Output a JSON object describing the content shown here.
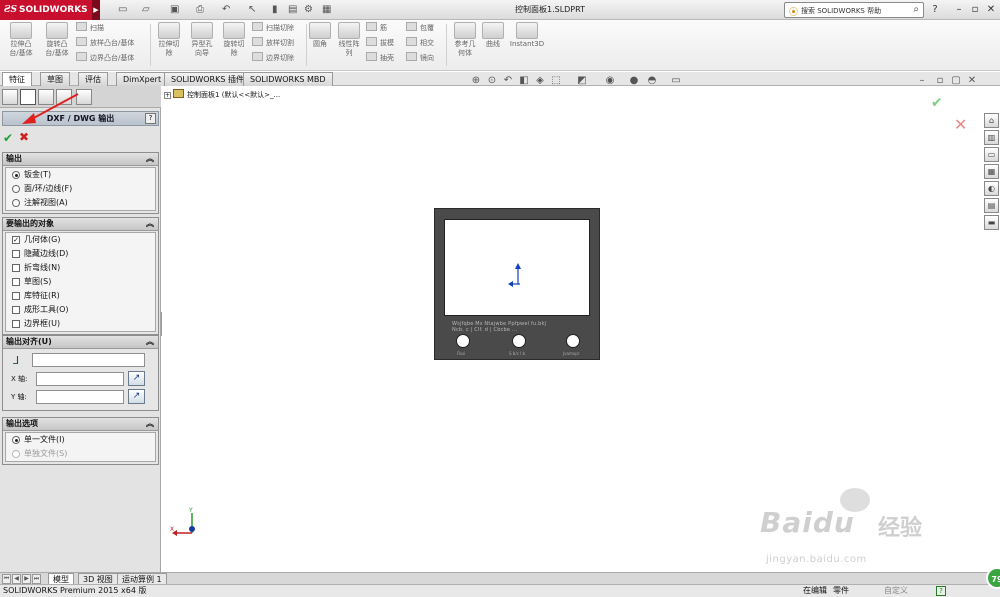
{
  "app": {
    "brand": "SOLIDWORKS",
    "document_title": "控制面板1.SLDPRT"
  },
  "search": {
    "placeholder": "搜索 SOLIDWORKS 帮助"
  },
  "icons": [
    "solidworks-logo",
    "new-icon",
    "open-icon",
    "save-icon",
    "print-icon",
    "undo-icon",
    "select-icon",
    "rebuild-icon",
    "options-icon",
    "search-icon",
    "help-icon",
    "minimize-icon",
    "restore-icon",
    "close-icon"
  ],
  "ribbon": {
    "big_buttons": [
      {
        "label": "拉伸凸\n台/基体"
      },
      {
        "label": "旋转凸\n台/基体"
      },
      {
        "label": "拉伸切\n除"
      },
      {
        "label": "异型孔\n向导"
      },
      {
        "label": "旋转切\n除"
      },
      {
        "label": "圆角"
      },
      {
        "label": "线性阵\n列"
      },
      {
        "label": "参考几\n何体"
      },
      {
        "label": "曲线"
      },
      {
        "label": "Instant3D"
      }
    ],
    "small_col1": [
      "扫描",
      "放样凸台/基体",
      "边界凸台/基体"
    ],
    "small_col2": [
      "扫描切除",
      "放样切割",
      "边界切除"
    ],
    "small_col3": [
      "筋",
      "拔模",
      "抽壳"
    ],
    "small_col4": [
      "包覆",
      "相交",
      "镜向"
    ]
  },
  "tabs": [
    "特征",
    "草图",
    "评估",
    "DimXpert",
    "SOLIDWORKS 插件",
    "SOLIDWORKS MBD"
  ],
  "pm": {
    "title": "DXF / DWG 输出",
    "help": "?",
    "groups": {
      "output": {
        "title": "输出",
        "options": [
          "钣金(T)",
          "面/环/边线(F)",
          "注解视图(A)"
        ],
        "selected": 0
      },
      "entities": {
        "title": "要输出的对象",
        "options": [
          "几何体(G)",
          "隐藏边线(D)",
          "折弯线(N)",
          "草图(S)",
          "库特征(R)",
          "成形工具(O)",
          "边界框(U)"
        ],
        "checked": [
          true,
          false,
          false,
          false,
          false,
          false,
          false
        ]
      },
      "align": {
        "title": "输出对齐(U)",
        "x_label": "X 轴:",
        "y_label": "Y 轴:"
      },
      "options": {
        "title": "输出选项",
        "items": [
          "单一文件(I)",
          "单独文件(S)"
        ],
        "selected": 0
      }
    }
  },
  "tree": {
    "node": "控制面板1",
    "config": "(默认<<默认>_..."
  },
  "part": {
    "label_text": "Wsjfqbe Ms Ntajwbe Ppfpwel fu.bkj",
    "label_text2": "Ncb. c   | Clf. d   | Cbcbe ...",
    "hole_labels": [
      "Fbvi",
      "S b/c l b",
      "Jvamxpr"
    ]
  },
  "triad": {
    "y": "Y",
    "x": "X"
  },
  "bottom_tabs": [
    "模型",
    "3D 视图",
    "运动算例 1"
  ],
  "status": {
    "left": "SOLIDWORKS Premium 2015 x64 版",
    "mode": "在编辑",
    "doc": "零件",
    "units": "自定义",
    "help": "?"
  },
  "watermark": {
    "brand_latin": "Bai",
    "brand_du": "du",
    "brand_cn": "经验",
    "url": "jingyan.baidu.com"
  },
  "badge": {
    "value": "79"
  },
  "colors": {
    "brand_red": "#c8102e",
    "ok_green": "#1aa032",
    "cancel_red": "#d02020",
    "annotation_arrow": "#e02020"
  }
}
